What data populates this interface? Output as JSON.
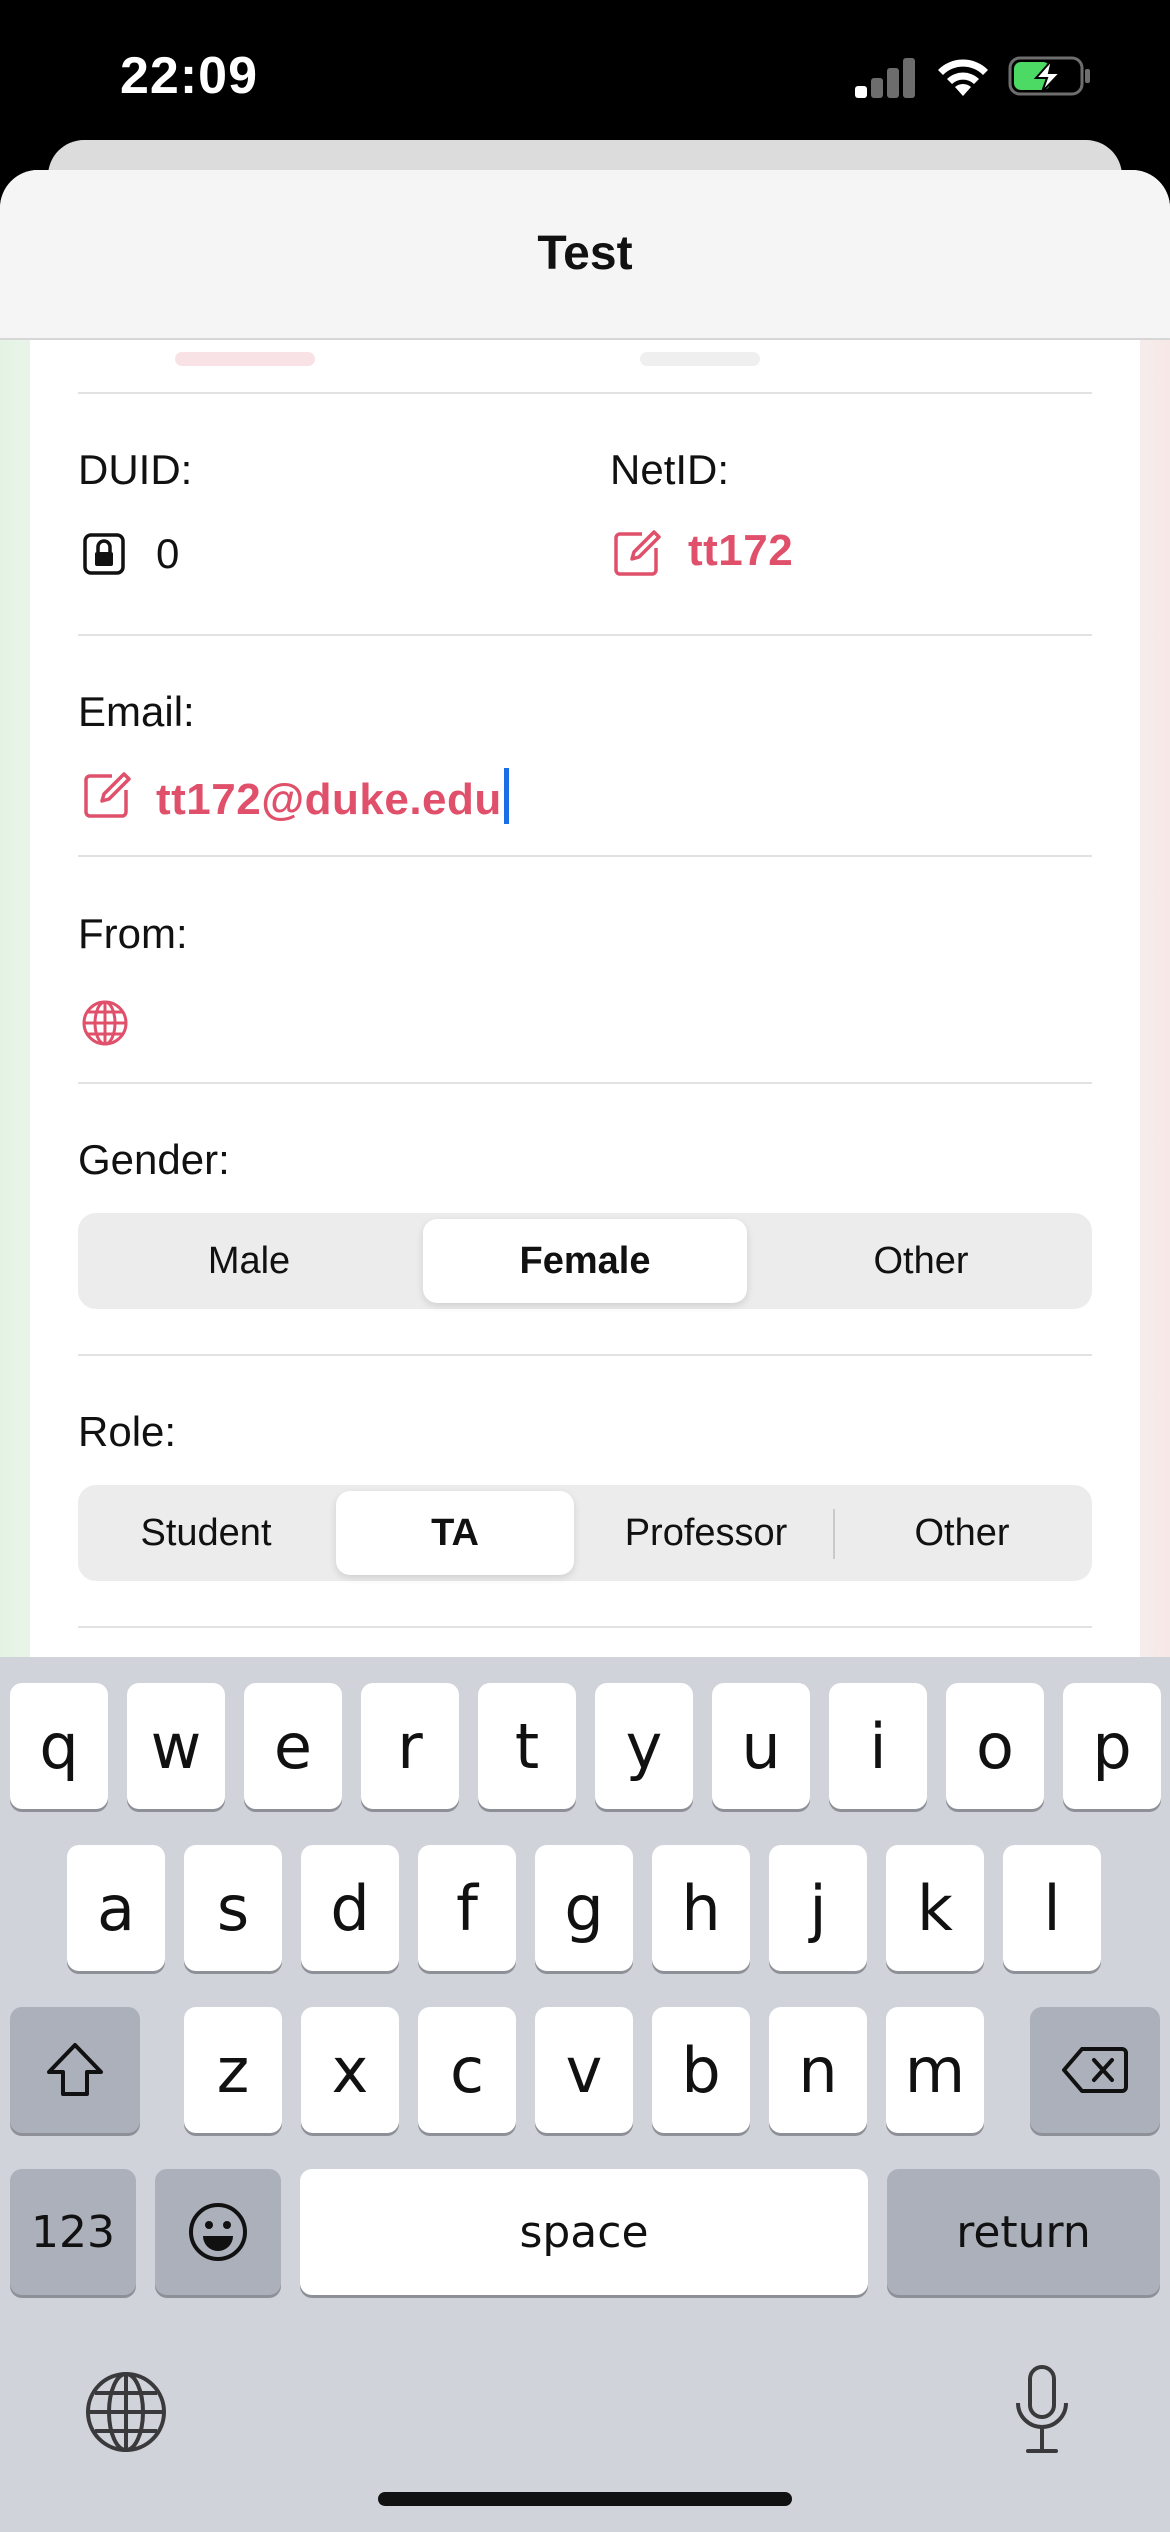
{
  "status_bar": {
    "time": "22:09"
  },
  "sheet": {
    "title": "Test"
  },
  "fields": {
    "duid": {
      "label": "DUID:",
      "value": "0"
    },
    "netid": {
      "label": "NetID:",
      "value": "tt172"
    },
    "email": {
      "label": "Email:",
      "value": "tt172@duke.edu"
    },
    "from": {
      "label": "From:"
    },
    "gender": {
      "label": "Gender:",
      "options": [
        "Male",
        "Female",
        "Other"
      ],
      "selected": "Female"
    },
    "role": {
      "label": "Role:",
      "options": [
        "Student",
        "TA",
        "Professor",
        "Other"
      ],
      "selected": "TA"
    }
  },
  "keyboard": {
    "row1": [
      "q",
      "w",
      "e",
      "r",
      "t",
      "y",
      "u",
      "i",
      "o",
      "p"
    ],
    "row2": [
      "a",
      "s",
      "d",
      "f",
      "g",
      "h",
      "j",
      "k",
      "l"
    ],
    "row3": [
      "z",
      "x",
      "c",
      "v",
      "b",
      "n",
      "m"
    ],
    "numbers_label": "123",
    "space_label": "space",
    "return_label": "return"
  },
  "colors": {
    "accent": "#e0506a",
    "cursor": "#1a6ee8",
    "keyboard_bg": "#d0d3da"
  }
}
